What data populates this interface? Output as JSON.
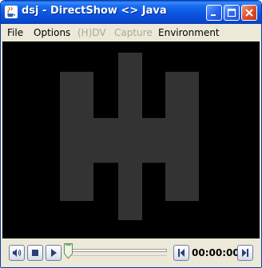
{
  "window": {
    "title": "dsj - DirectShow <> Java",
    "app_icon": "java-cup-icon",
    "buttons": {
      "minimize": "minimize-icon",
      "maximize": "maximize-icon",
      "close": "close-icon"
    }
  },
  "menu": {
    "items": [
      {
        "label": "File",
        "enabled": true
      },
      {
        "label": "Options",
        "enabled": true
      },
      {
        "label": "(H)DV",
        "enabled": false
      },
      {
        "label": "Capture",
        "enabled": false
      },
      {
        "label": "Environment",
        "enabled": true
      }
    ]
  },
  "video": {
    "logo": "dsj-h-logo",
    "background": "#000000",
    "logo_color": "#333333"
  },
  "controls": {
    "icons": {
      "volume": "speaker-icon",
      "stop": "stop-icon",
      "play": "play-icon",
      "frame_back": "step-back-icon",
      "frame_forward": "step-forward-icon"
    },
    "seek_position": 0,
    "time": "00:00:00"
  },
  "colors": {
    "titlebar": "#0a55e0",
    "window_bg": "#ece9d8",
    "close": "#e0502e"
  }
}
